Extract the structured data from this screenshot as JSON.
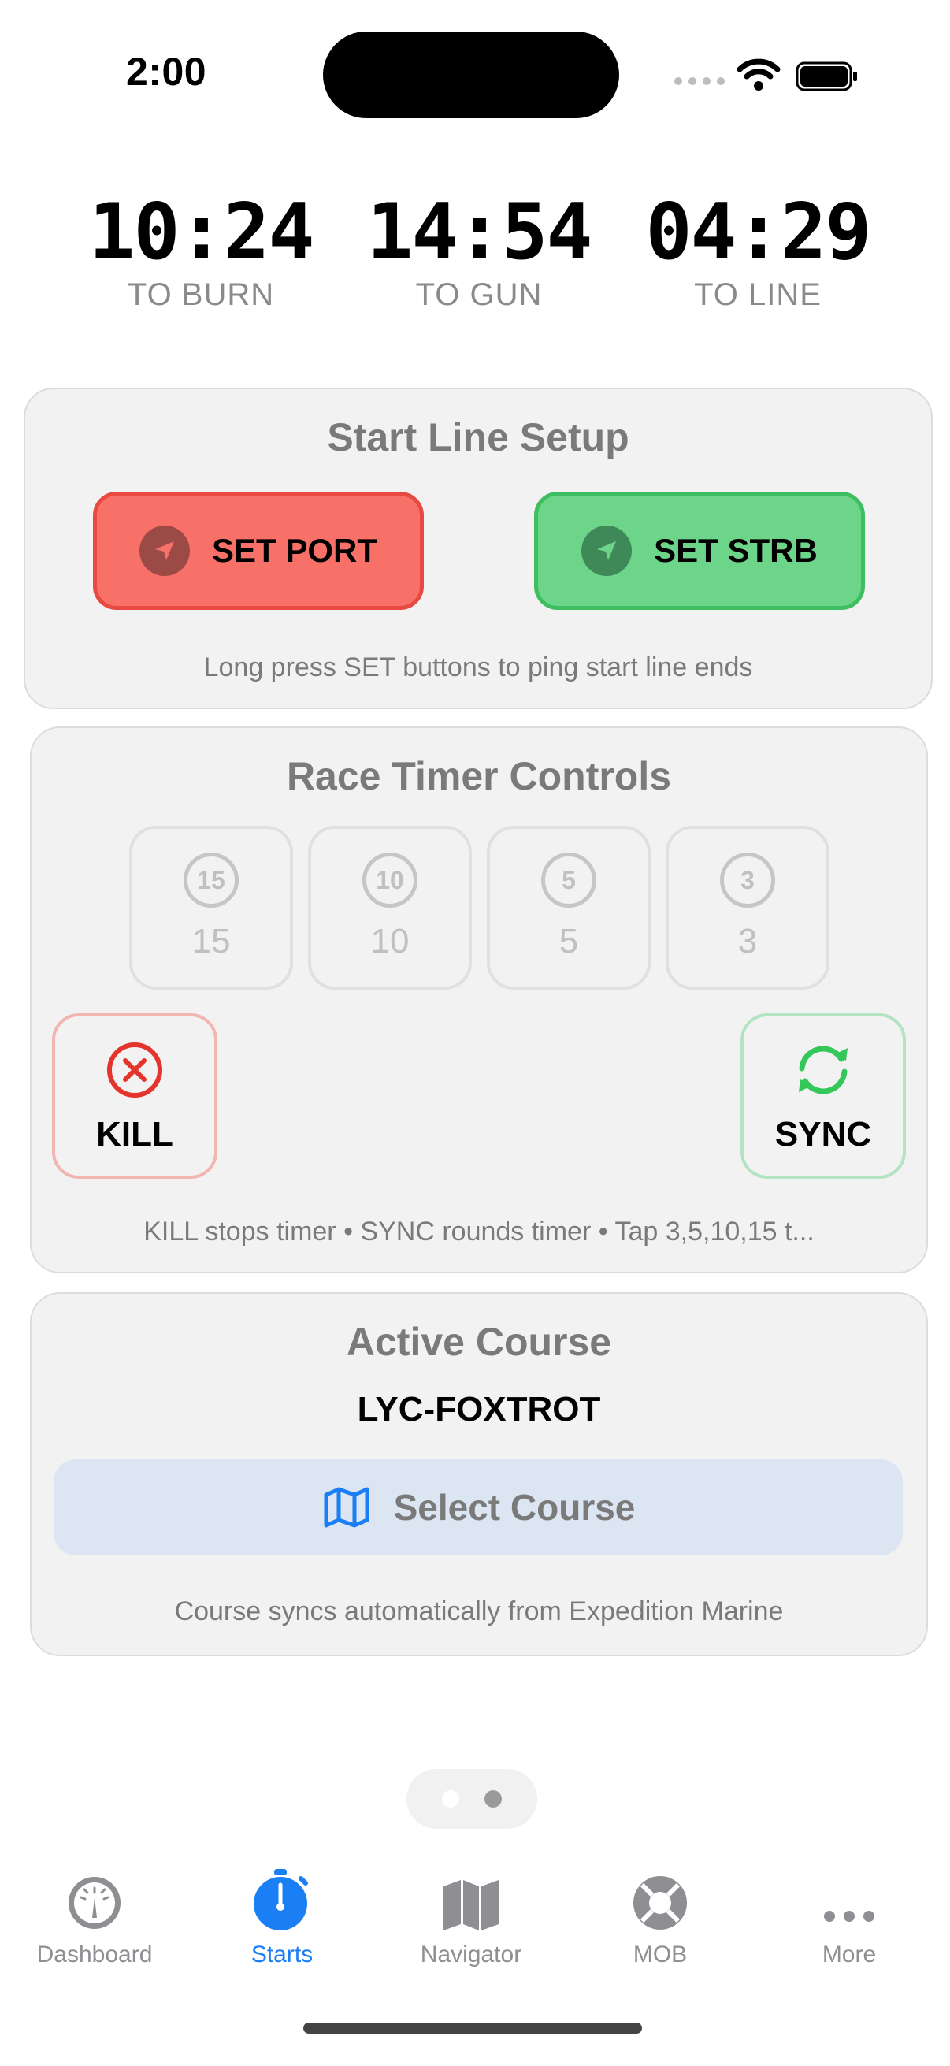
{
  "status": {
    "time": "2:00"
  },
  "timers": [
    {
      "value": "10:24",
      "label": "TO BURN"
    },
    {
      "value": "14:54",
      "label": "TO GUN"
    },
    {
      "value": "04:29",
      "label": "TO LINE"
    }
  ],
  "start_line": {
    "title": "Start Line Setup",
    "port_label": "SET PORT",
    "strb_label": "SET STRB",
    "note": "Long press SET buttons to ping start line ends",
    "colors": {
      "port": "#f87168",
      "strb": "#6dd58a"
    }
  },
  "race_timer": {
    "title": "Race Timer Controls",
    "presets": [
      {
        "icon": "15",
        "label": "15"
      },
      {
        "icon": "10",
        "label": "10"
      },
      {
        "icon": "5",
        "label": "5"
      },
      {
        "icon": "3",
        "label": "3"
      }
    ],
    "kill_label": "KILL",
    "sync_label": "SYNC",
    "note": "KILL stops timer • SYNC rounds timer • Tap 3,5,10,15 t...",
    "colors": {
      "kill": "#e5342c",
      "sync": "#34c759"
    }
  },
  "course": {
    "title": "Active Course",
    "name": "LYC-FOXTROT",
    "select_label": "Select Course",
    "note": "Course syncs automatically from Expedition Marine",
    "accent": "#1a7ef5"
  },
  "pager": {
    "pages": 2,
    "current": 2
  },
  "tabs": [
    {
      "label": "Dashboard",
      "icon": "gauge-icon",
      "active": false
    },
    {
      "label": "Starts",
      "icon": "stopwatch-icon",
      "active": true
    },
    {
      "label": "Navigator",
      "icon": "map-icon",
      "active": false
    },
    {
      "label": "MOB",
      "icon": "lifebuoy-icon",
      "active": false
    },
    {
      "label": "More",
      "icon": "ellipsis-icon",
      "active": false
    }
  ]
}
